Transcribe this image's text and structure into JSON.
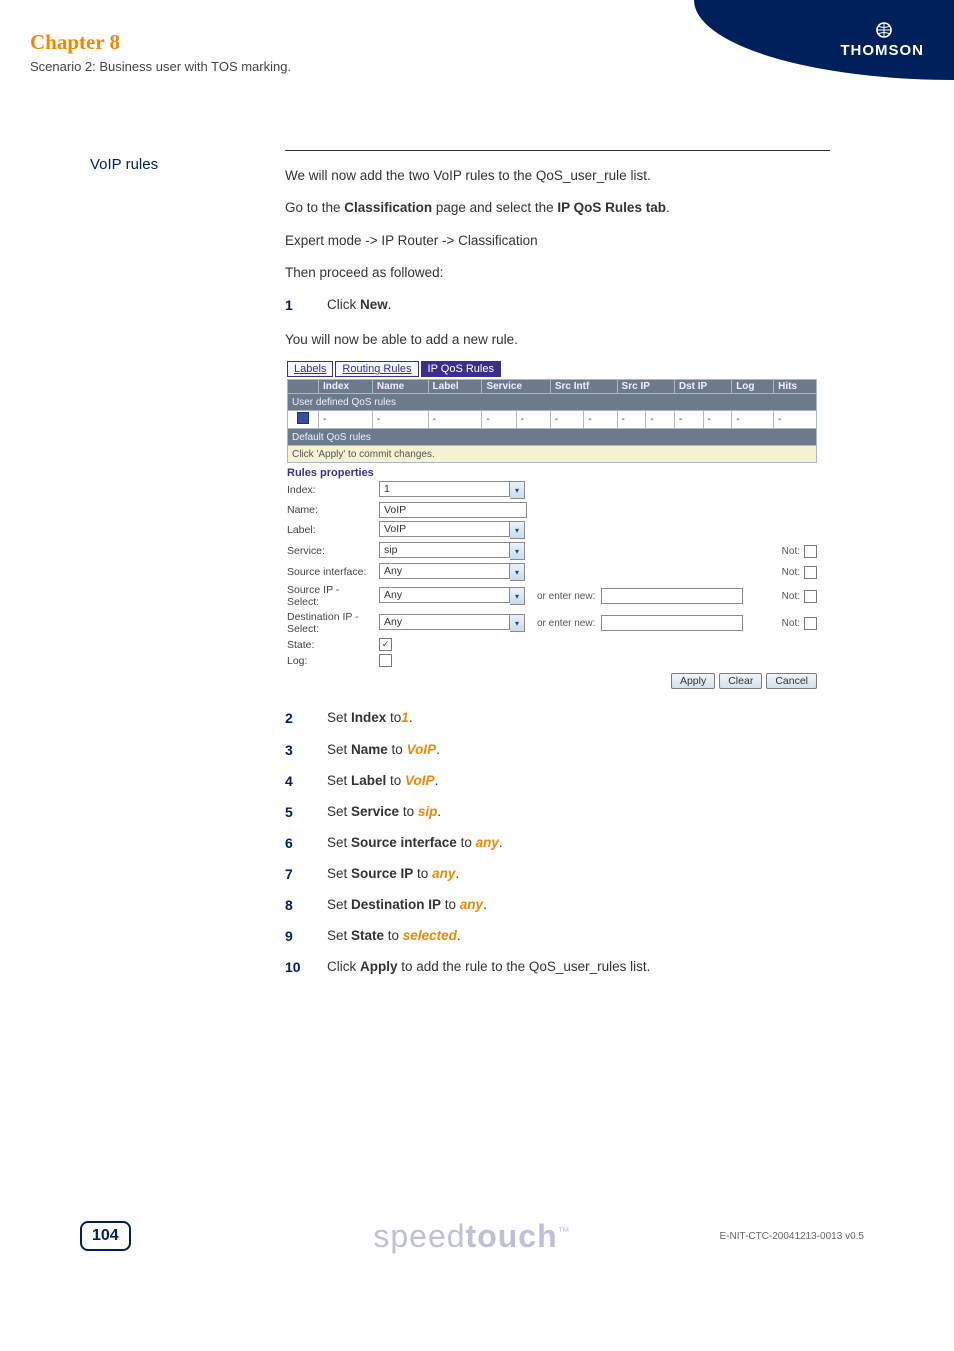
{
  "header": {
    "chapter": "Chapter 8",
    "scenario": "Scenario 2: Business user with TOS marking.",
    "brand": "THOMSON"
  },
  "section": {
    "heading": "VoIP rules",
    "intro1_pre": "We will now add the two VoIP rules to the QoS_user_rule list.",
    "intro2_a": "Go to the ",
    "intro2_b": "Classification",
    "intro2_c": " page and select the ",
    "intro2_d": "IP QoS Rules tab",
    "intro2_e": ".",
    "intro3": "Expert mode -> IP Router -> Classification",
    "intro4": "Then proceed as followed:",
    "after_click": "You will now be able to add a new rule."
  },
  "steps_before": {
    "n1": "1",
    "t1a": "Click ",
    "t1b": "New",
    "t1c": "."
  },
  "ui": {
    "tabs": {
      "labels": "Labels",
      "routing": "Routing Rules",
      "ipqos": "IP QoS Rules"
    },
    "cols": {
      "c0": "",
      "c1": "Index",
      "c2": "Name",
      "c3": "Label",
      "c4": "Service",
      "c5": "Src Intf",
      "c6": "Src IP",
      "c7": "Dst IP",
      "c8": "Log",
      "c9": "Hits"
    },
    "rows": {
      "user_header": "User defined QoS rules",
      "default_header": "Default QoS rules",
      "yellow": "Click 'Apply' to commit changes."
    },
    "props_title": "Rules properties",
    "labels": {
      "index": "Index:",
      "name": "Name:",
      "label": "Label:",
      "service": "Service:",
      "srcintf": "Source interface:",
      "srcip": "Source IP - Select:",
      "dstip": "Destination IP - Select:",
      "state": "State:",
      "log": "Log:",
      "enter": "or enter new:",
      "not": "Not:"
    },
    "values": {
      "index": "1",
      "name": "VoIP",
      "label": "VoIP",
      "service": "sip",
      "srcintf": "Any",
      "srcip": "Any",
      "dstip": "Any",
      "state_checked": "✓"
    },
    "buttons": {
      "apply": "Apply",
      "clear": "Clear",
      "cancel": "Cancel"
    }
  },
  "steps_after": [
    {
      "n": "2",
      "pre": "Set ",
      "b": "Index",
      "mid": " to",
      "val": "1",
      "post": "."
    },
    {
      "n": "3",
      "pre": "Set ",
      "b": "Name",
      "mid": " to ",
      "val": "VoIP",
      "post": "."
    },
    {
      "n": "4",
      "pre": "Set ",
      "b": "Label",
      "mid": " to ",
      "val": "VoIP",
      "post": "."
    },
    {
      "n": "5",
      "pre": "Set ",
      "b": "Service",
      "mid": " to ",
      "val": "sip",
      "post": "."
    },
    {
      "n": "6",
      "pre": "Set ",
      "b": "Source interface",
      "mid": " to ",
      "val": "any",
      "post": "."
    },
    {
      "n": "7",
      "pre": "Set ",
      "b": "Source IP",
      "mid": " to ",
      "val": "any",
      "post": "."
    },
    {
      "n": "8",
      "pre": "Set ",
      "b": "Destination IP",
      "mid": " to ",
      "val": "any",
      "post": "."
    },
    {
      "n": "9",
      "pre": "Set ",
      "b": "State",
      "mid": " to ",
      "val": "selected",
      "post": "."
    },
    {
      "n": "10",
      "pre": "Click ",
      "b": "Apply",
      "mid": " to add the rule to the QoS_user_rules list.",
      "val": "",
      "post": ""
    }
  ],
  "footer": {
    "page": "104",
    "brand_light": "speed",
    "brand_bold": "touch",
    "tm": "™",
    "docref": "E-NIT-CTC-20041213-0013 v0.5"
  }
}
